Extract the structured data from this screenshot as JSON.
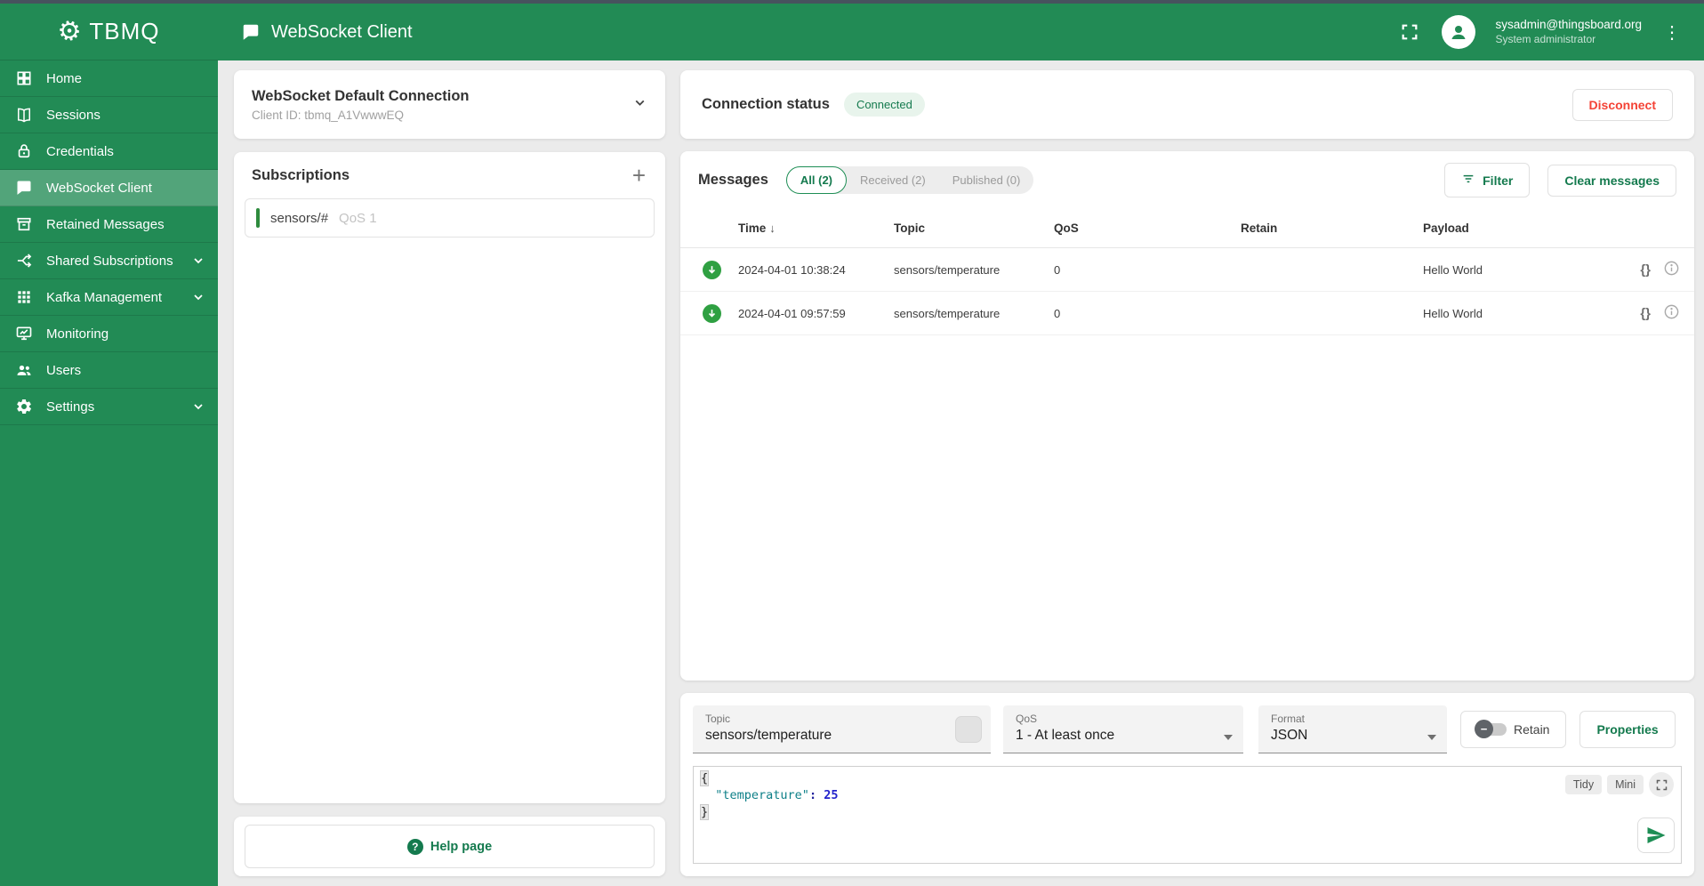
{
  "colors": {
    "primary": "#228b55",
    "accent": "#147a4e",
    "accent-green": "#1e8e55",
    "row-green": "#2fa042",
    "red": "#f44336",
    "topbar": "#47525e",
    "bg": "#ebebeb"
  },
  "app": {
    "name": "TBMQ",
    "page_title": "WebSocket Client"
  },
  "user": {
    "email": "sysadmin@thingsboard.org",
    "role": "System administrator"
  },
  "sidebar": {
    "items": [
      {
        "label": "Home",
        "icon": "home-icon",
        "expandable": false,
        "active": false
      },
      {
        "label": "Sessions",
        "icon": "sessions-icon",
        "expandable": false,
        "active": false
      },
      {
        "label": "Credentials",
        "icon": "credentials-icon",
        "expandable": false,
        "active": false
      },
      {
        "label": "WebSocket Client",
        "icon": "websocket-client-icon",
        "expandable": false,
        "active": true
      },
      {
        "label": "Retained Messages",
        "icon": "retained-messages-icon",
        "expandable": false,
        "active": false
      },
      {
        "label": "Shared Subscriptions",
        "icon": "shared-subscriptions-icon",
        "expandable": true,
        "active": false
      },
      {
        "label": "Kafka Management",
        "icon": "kafka-management-icon",
        "expandable": true,
        "active": false
      },
      {
        "label": "Monitoring",
        "icon": "monitoring-icon",
        "expandable": false,
        "active": false
      },
      {
        "label": "Users",
        "icon": "users-icon",
        "expandable": false,
        "active": false
      },
      {
        "label": "Settings",
        "icon": "settings-icon",
        "expandable": true,
        "active": false
      }
    ]
  },
  "connection": {
    "name": "WebSocket Default Connection",
    "client_id": "Client ID: tbmq_A1VwwwEQ",
    "status_label": "Connection status",
    "status": "Connected",
    "disconnect_label": "Disconnect"
  },
  "subscriptions": {
    "title": "Subscriptions",
    "items": [
      {
        "topic": "sensors/#",
        "qos": "QoS 1"
      }
    ]
  },
  "help": {
    "label": "Help page",
    "icon_glyph": "?"
  },
  "messages": {
    "title": "Messages",
    "tabs": [
      {
        "label": "All (2)",
        "active": true
      },
      {
        "label": "Received (2)",
        "active": false
      },
      {
        "label": "Published (0)",
        "active": false
      }
    ],
    "filter_label": "Filter",
    "clear_label": "Clear messages",
    "columns": [
      "Time",
      "Topic",
      "QoS",
      "Retain",
      "Payload"
    ],
    "sort_icon": "↓",
    "braces_label": "{}",
    "rows": [
      {
        "time": "2024-04-01 10:38:24",
        "topic": "sensors/temperature",
        "qos": "0",
        "retain": "",
        "payload": "Hello World"
      },
      {
        "time": "2024-04-01 09:57:59",
        "topic": "sensors/temperature",
        "qos": "0",
        "retain": "",
        "payload": "Hello World"
      }
    ]
  },
  "publish": {
    "topic_label": "Topic",
    "topic_value": "sensors/temperature",
    "qos_label": "QoS",
    "qos_value": "1 - At least once",
    "format_label": "Format",
    "format_value": "JSON",
    "retain_label": "Retain",
    "retain_thumb_glyph": "−",
    "properties_label": "Properties",
    "editor": {
      "open_brace": "{",
      "key": "\"temperature\"",
      "colon": ":",
      "value": "25",
      "close_brace": "}",
      "tidy_label": "Tidy",
      "mini_label": "Mini"
    }
  }
}
